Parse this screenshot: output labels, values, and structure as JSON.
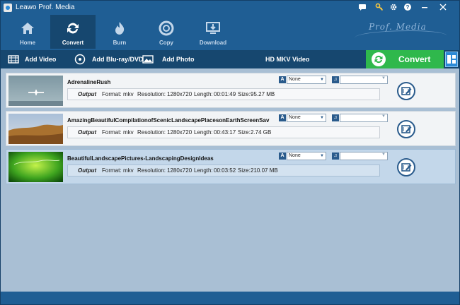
{
  "window": {
    "title": "Leawo Prof. Media",
    "brand": "Prof. Media"
  },
  "titlebar_icons": [
    "chat-icon",
    "key-icon",
    "gear-icon",
    "help-icon",
    "minimize-icon",
    "close-icon"
  ],
  "nav": [
    {
      "label": "Home",
      "icon": "home-icon",
      "active": false
    },
    {
      "label": "Convert",
      "icon": "convert-icon",
      "active": true
    },
    {
      "label": "Burn",
      "icon": "burn-icon",
      "active": false
    },
    {
      "label": "Copy",
      "icon": "copy-icon",
      "active": false
    },
    {
      "label": "Download",
      "icon": "download-icon",
      "active": false
    }
  ],
  "toolbar": {
    "add_video": "Add Video",
    "add_bluray": "Add Blu-ray/DVD",
    "add_photo": "Add Photo",
    "format_label": "HD MKV Video",
    "convert_label": "Convert"
  },
  "colors": {
    "accent": "#2fb84c",
    "header": "#1f5e94",
    "toolbar": "#16476f"
  },
  "files": [
    {
      "name": "AdrenalineRush",
      "output": "Output",
      "format_key": "Format:",
      "format": "mkv",
      "resolution_key": "Resolution:",
      "resolution": "1280x720",
      "length_key": "Length:",
      "length": "00:01:49",
      "size_key": "Size:",
      "size": "95.27 MB",
      "subtitle": "None",
      "audio": "",
      "selected": false
    },
    {
      "name": "AmazingBeautifulCompilationofScenicLandscapePlacesonEarthScreenSav",
      "output": "Output",
      "format_key": "Format:",
      "format": "mkv",
      "resolution_key": "Resolution:",
      "resolution": "1280x720",
      "length_key": "Length:",
      "length": "00:43:17",
      "size_key": "Size:",
      "size": "2.74 GB",
      "subtitle": "None",
      "audio": "",
      "selected": false
    },
    {
      "name": "BeautifulLandscapePictures-LandscapingDesignIdeas",
      "output": "Output",
      "format_key": "Format:",
      "format": "mkv",
      "resolution_key": "Resolution:",
      "resolution": "1280x720",
      "length_key": "Length:",
      "length": "00:03:52",
      "size_key": "Size:",
      "size": "210.07 MB",
      "subtitle": "None",
      "audio": "",
      "selected": true
    }
  ]
}
